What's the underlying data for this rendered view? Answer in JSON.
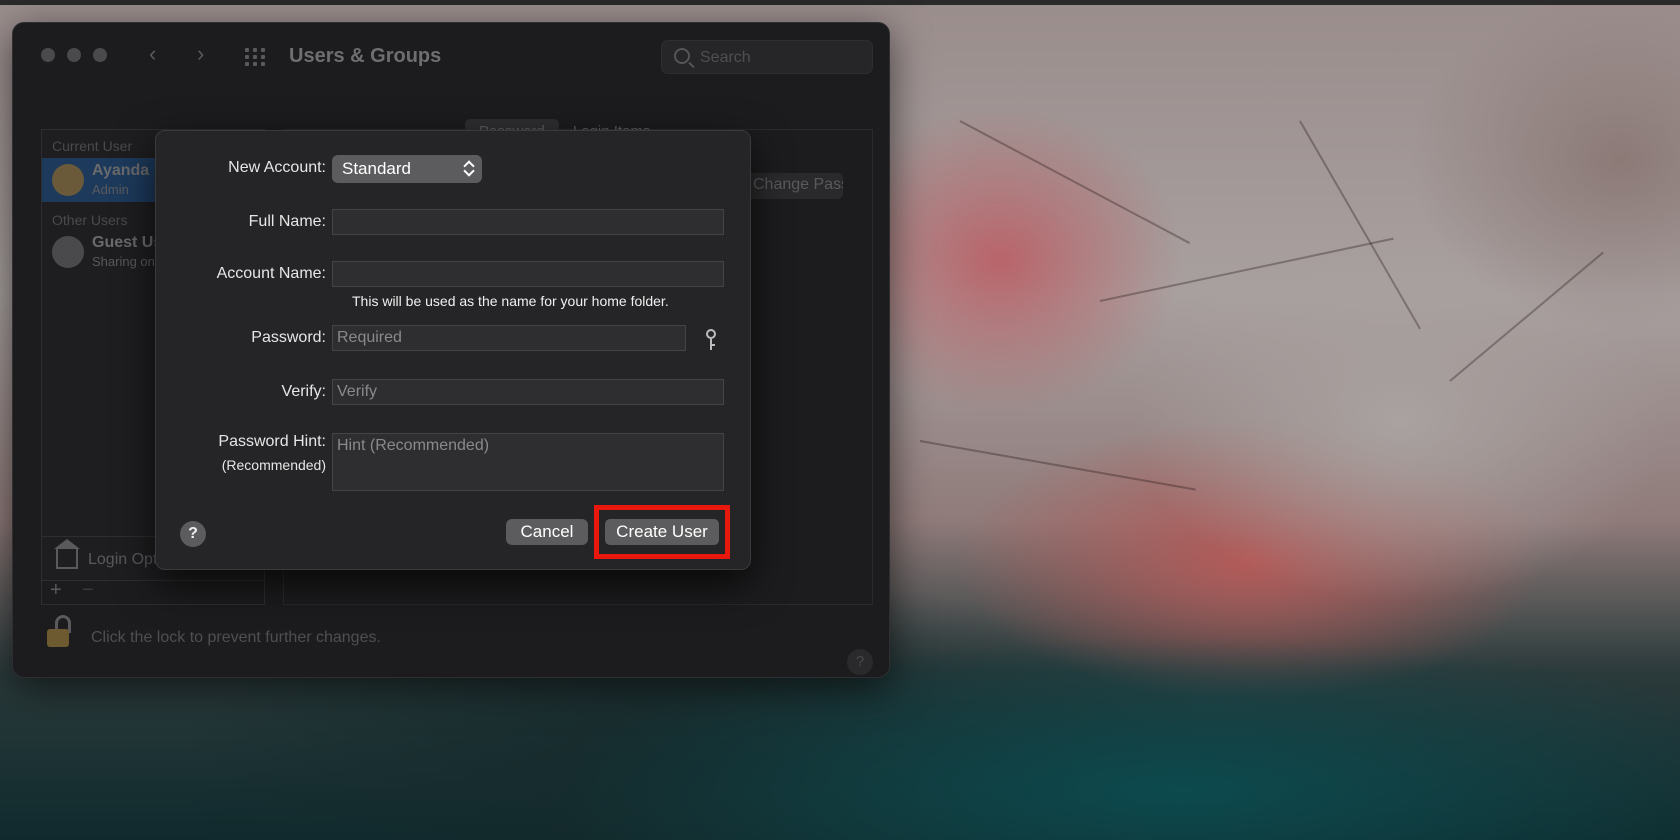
{
  "window": {
    "title": "Users & Groups",
    "search_placeholder": "Search"
  },
  "sidebar": {
    "current_user_heading": "Current User",
    "current_user_name": "Ayanda",
    "current_user_role": "Admin",
    "other_users_heading": "Other Users",
    "guest_name": "Guest User",
    "guest_sub": "Sharing only",
    "login_options_label": "Login Options",
    "add_label": "+",
    "remove_label": "−"
  },
  "tabs": [
    "Password",
    "Login Items"
  ],
  "change_password_label": "Change Password...",
  "lock_text": "Click the lock to prevent further changes.",
  "background_help": "?",
  "sheet": {
    "new_account_label": "New Account:",
    "new_account_value": "Standard",
    "full_name_label": "Full Name:",
    "full_name_value": "",
    "account_name_label": "Account Name:",
    "account_name_value": "",
    "account_name_hint": "This will be used as the name for your home folder.",
    "password_label": "Password:",
    "password_placeholder": "Required",
    "verify_label": "Verify:",
    "verify_placeholder": "Verify",
    "password_hint_label": "Password Hint:",
    "password_hint_sub": "(Recommended)",
    "password_hint_placeholder": "Hint (Recommended)",
    "help_label": "?",
    "cancel_label": "Cancel",
    "create_label": "Create User"
  },
  "colors": {
    "highlight": "#e8180c",
    "selection": "#1d3a5c"
  }
}
